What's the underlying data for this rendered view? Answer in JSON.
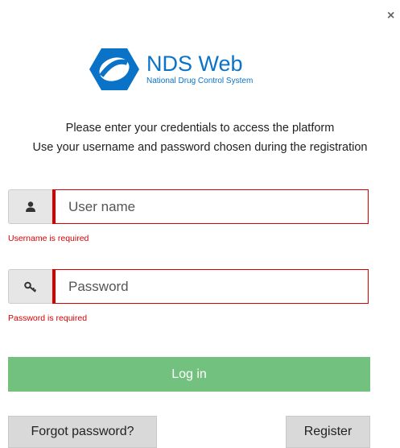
{
  "dialog": {
    "close_label": "×"
  },
  "logo": {
    "title": "NDS Web",
    "subtitle": "National Drug Control System",
    "brand_color": "#0a73c8"
  },
  "intro": {
    "line1": "Please enter your credentials to access the platform",
    "line2": "Use your username and password chosen during the registration"
  },
  "username": {
    "placeholder": "User name",
    "value": "",
    "error": "Username is required",
    "icon": "user-icon"
  },
  "password": {
    "placeholder": "Password",
    "value": "",
    "error": "Password is required",
    "icon": "key-icon"
  },
  "actions": {
    "login_label": "Log in",
    "forgot_label": "Forgot password?",
    "register_label": "Register"
  },
  "colors": {
    "error": "#d60000",
    "login_button": "#72c17f",
    "secondary_button": "#d9d9d9"
  }
}
